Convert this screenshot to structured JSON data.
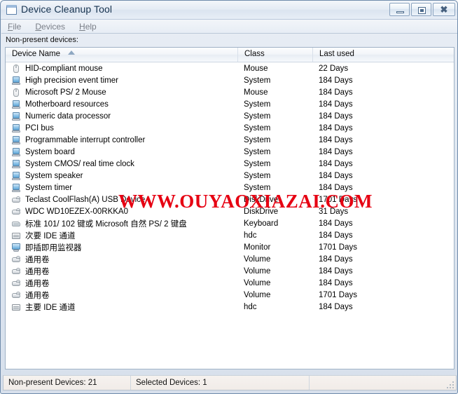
{
  "window": {
    "title": "Device Cleanup Tool",
    "icon": "window-app-icon",
    "controls": {
      "minimize": "minimize-button",
      "maximize": "maximize-button",
      "close": "close-button"
    }
  },
  "menu": {
    "items": [
      {
        "accel": "F",
        "rest": "ile"
      },
      {
        "accel": "D",
        "rest": "evices"
      },
      {
        "accel": "H",
        "rest": "elp"
      }
    ]
  },
  "body": {
    "section_label": "Non-present devices:"
  },
  "list": {
    "columns": [
      {
        "label": "Device Name",
        "sorted": "ascending"
      },
      {
        "label": "Class",
        "sorted": ""
      },
      {
        "label": "Last used",
        "sorted": ""
      }
    ],
    "rows": [
      {
        "icon": "mouse-icon",
        "name": "HID-compliant mouse",
        "class": "Mouse",
        "last_used": "22 Days"
      },
      {
        "icon": "system-icon",
        "name": "High precision event timer",
        "class": "System",
        "last_used": "184 Days"
      },
      {
        "icon": "mouse-icon",
        "name": "Microsoft PS/ 2 Mouse",
        "class": "Mouse",
        "last_used": "184 Days"
      },
      {
        "icon": "system-icon",
        "name": "Motherboard resources",
        "class": "System",
        "last_used": "184 Days"
      },
      {
        "icon": "system-icon",
        "name": "Numeric data processor",
        "class": "System",
        "last_used": "184 Days"
      },
      {
        "icon": "system-icon",
        "name": "PCI bus",
        "class": "System",
        "last_used": "184 Days"
      },
      {
        "icon": "system-icon",
        "name": "Programmable interrupt controller",
        "class": "System",
        "last_used": "184 Days"
      },
      {
        "icon": "system-icon",
        "name": "System board",
        "class": "System",
        "last_used": "184 Days"
      },
      {
        "icon": "system-icon",
        "name": "System CMOS/ real time clock",
        "class": "System",
        "last_used": "184 Days"
      },
      {
        "icon": "system-icon",
        "name": "System speaker",
        "class": "System",
        "last_used": "184 Days"
      },
      {
        "icon": "system-icon",
        "name": "System timer",
        "class": "System",
        "last_used": "184 Days"
      },
      {
        "icon": "disk-icon",
        "name": "Teclast CoolFlash(A) USB Device",
        "class": "DiskDrive",
        "last_used": "1701 Days"
      },
      {
        "icon": "disk-icon",
        "name": "WDC WD10EZEX-00RKKA0",
        "class": "DiskDrive",
        "last_used": "31 Days"
      },
      {
        "icon": "keyboard-icon",
        "name": "标准 101/ 102 键或 Microsoft 自然 PS/ 2 键盘",
        "class": "Keyboard",
        "last_used": "184 Days"
      },
      {
        "icon": "ide-icon",
        "name": "次要 IDE 通道",
        "class": "hdc",
        "last_used": "184 Days"
      },
      {
        "icon": "monitor-icon",
        "name": "即插即用监视器",
        "class": "Monitor",
        "last_used": "1701 Days"
      },
      {
        "icon": "disk-icon",
        "name": "通用卷",
        "class": "Volume",
        "last_used": "184 Days"
      },
      {
        "icon": "disk-icon",
        "name": "通用卷",
        "class": "Volume",
        "last_used": "184 Days"
      },
      {
        "icon": "disk-icon",
        "name": "通用卷",
        "class": "Volume",
        "last_used": "184 Days"
      },
      {
        "icon": "disk-icon",
        "name": "通用卷",
        "class": "Volume",
        "last_used": "1701 Days"
      },
      {
        "icon": "ide-icon",
        "name": "主要 IDE 通道",
        "class": "hdc",
        "last_used": "184 Days"
      }
    ]
  },
  "watermark": {
    "text": "WWW.OUYAOXIAZAI.COM",
    "color": "#e60012"
  },
  "statusbar": {
    "panes": [
      "Non-present Devices: 21",
      "Selected Devices: 1",
      ""
    ]
  }
}
